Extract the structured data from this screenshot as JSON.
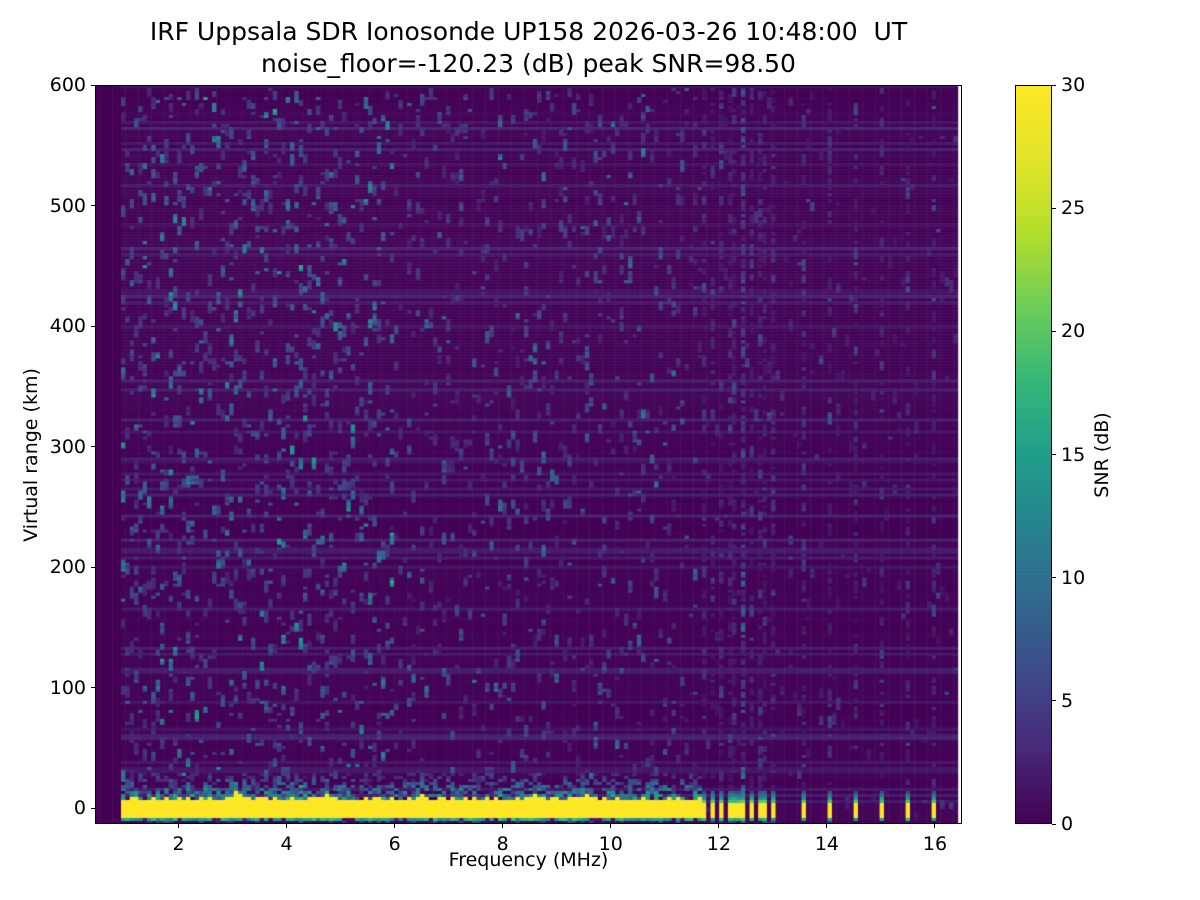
{
  "figure": {
    "background": "#ffffff"
  },
  "chart_data": {
    "type": "heatmap",
    "title": "IRF Uppsala SDR Ionosonde UP158 2026-03-26 10:48:00  UT",
    "subtitle": "noise_floor=-120.23 (dB) peak SNR=98.50",
    "station": "UP158",
    "datetime_ut": "2026-03-26 10:48:00 UT",
    "noise_floor_db": -120.23,
    "peak_snr_db": 98.5,
    "xlabel": "Frequency (MHz)",
    "ylabel": "Virtual range (km)",
    "xlim": [
      0.455,
      16.5
    ],
    "ylim": [
      -13,
      600
    ],
    "xticks": [
      2,
      4,
      6,
      8,
      10,
      12,
      14,
      16
    ],
    "yticks": [
      0,
      100,
      200,
      300,
      400,
      500,
      600
    ],
    "colorbar": {
      "label": "SNR (dB)",
      "min": 0,
      "max": 30,
      "ticks": [
        0,
        5,
        10,
        15,
        20,
        25,
        30
      ],
      "colormap": "viridis"
    },
    "colormap_stops": [
      [
        68,
        1,
        84
      ],
      [
        72,
        40,
        120
      ],
      [
        62,
        74,
        137
      ],
      [
        49,
        104,
        142
      ],
      [
        38,
        130,
        142
      ],
      [
        31,
        158,
        137
      ],
      [
        53,
        183,
        121
      ],
      [
        109,
        205,
        89
      ],
      [
        180,
        222,
        44
      ],
      [
        226,
        228,
        40
      ],
      [
        253,
        231,
        37
      ]
    ],
    "background_color": "#440154",
    "saturated_color": "#fde725",
    "seed": 7,
    "features": {
      "sweep_start_mhz": 0.9,
      "data_end_mhz": 16.38,
      "ground_pulse": {
        "freq_range_mhz": [
          0.9,
          11.65
        ],
        "range_km": [
          -8,
          8
        ],
        "snr_db": 30
      },
      "sub_pulse_echo_km": [
        -11,
        -8.3
      ],
      "discrete_pulse_freqs_mhz": [
        11.72,
        11.88,
        12.05,
        12.24,
        12.42,
        12.61,
        12.81,
        13.02,
        13.55,
        14.05,
        14.52,
        15.0,
        15.5,
        16.0
      ],
      "interference_stripes_mhz": [
        12.42
      ],
      "band_bumps": [
        {
          "f": 3.1,
          "dkm": 6
        },
        {
          "f": 4.75,
          "dkm": 4
        },
        {
          "f": 6.5,
          "dkm": 3
        },
        {
          "f": 8.6,
          "dkm": 3
        },
        {
          "f": 9.55,
          "dkm": 3
        }
      ],
      "noise_speckle": [
        {
          "freq_range_mhz": [
            0.9,
            6.0
          ],
          "density": 0.085,
          "max_snr_db": 18
        },
        {
          "freq_range_mhz": [
            6.0,
            11.65
          ],
          "density": 0.05,
          "max_snr_db": 13
        },
        {
          "freq_range_mhz": [
            11.65,
            16.38
          ],
          "density": 0.016,
          "max_snr_db": 8
        }
      ]
    }
  }
}
